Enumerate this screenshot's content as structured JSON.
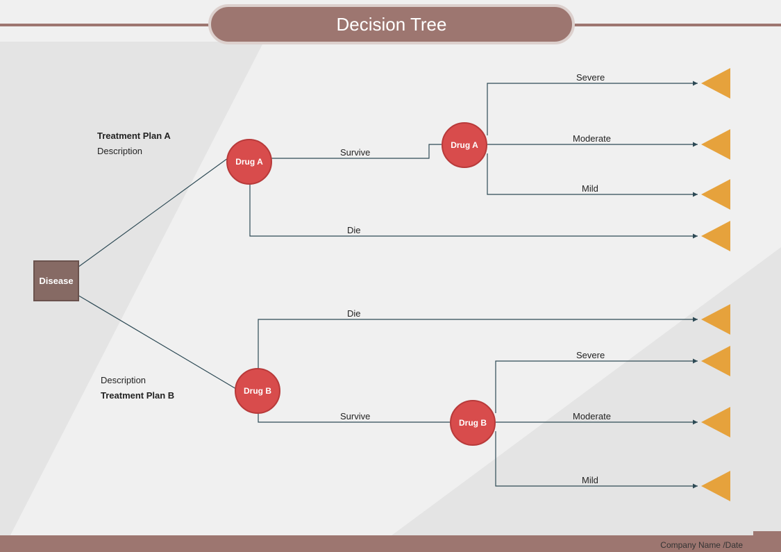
{
  "title": "Decision Tree",
  "root": {
    "label": "Disease"
  },
  "planA": {
    "title": "Treatment Plan A",
    "desc": "Description",
    "node1": "Drug A",
    "edge_survive": "Survive",
    "edge_die": "Die",
    "node2": "Drug A",
    "out": {
      "severe": "Severe",
      "moderate": "Moderate",
      "mild": "Mild"
    }
  },
  "planB": {
    "title": "Treatment Plan B",
    "desc": "Description",
    "node1": "Drug  B",
    "edge_survive": "Survive",
    "edge_die": "Die",
    "node2": "Drug  B",
    "out": {
      "severe": "Severe",
      "moderate": "Moderate",
      "mild": "Mild"
    }
  },
  "footer": "Company Name /Date"
}
